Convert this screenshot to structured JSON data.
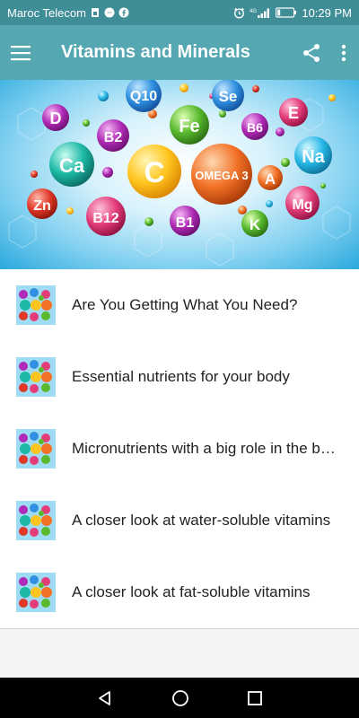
{
  "status_bar": {
    "carrier": "Maroc Telecom",
    "network": "4G",
    "time": "10:29 PM",
    "icons": [
      "sim-icon",
      "messenger-icon",
      "facebook-icon",
      "alarm-icon",
      "signal-icon",
      "battery-icon"
    ]
  },
  "app_bar": {
    "title": "Vitamins and Minerals",
    "menu_icon": "hamburger-menu-icon",
    "share_icon": "share-icon",
    "overflow_icon": "more-vert-icon"
  },
  "hero": {
    "labels": [
      "D",
      "Q10",
      "Se",
      "E",
      "B2",
      "Fe",
      "B6",
      "Ca",
      "C",
      "OMEGA 3",
      "A",
      "Na",
      "Zn",
      "B12",
      "B1",
      "K",
      "Mg"
    ]
  },
  "list": {
    "items": [
      {
        "label": "Are You Getting What You Need?"
      },
      {
        "label": "Essential nutrients for your body"
      },
      {
        "label": "Micronutrients with a big role in the body"
      },
      {
        "label": "A closer look at water-soluble vitamins"
      },
      {
        "label": "A closer look at fat-soluble vitamins"
      }
    ]
  },
  "nav_bar": {
    "back_icon": "back-icon",
    "home_icon": "home-icon",
    "recents_icon": "recents-icon"
  },
  "colors": {
    "status_bar": "#3f8d96",
    "app_bar": "#55a8b2",
    "list_background": "#ffffff",
    "nav_bar": "#000000"
  }
}
